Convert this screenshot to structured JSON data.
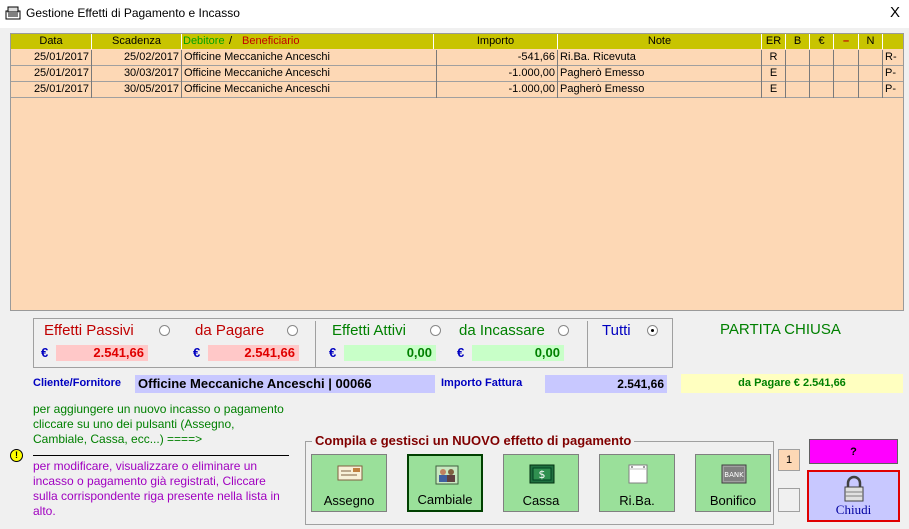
{
  "window": {
    "title": "Gestione Effetti di Pagamento e Incasso",
    "close_label": "X"
  },
  "grid": {
    "headers": {
      "data": "Data",
      "scadenza": "Scadenza",
      "debitore": "Debitore",
      "slash": "/",
      "beneficiario": "Beneficiario",
      "importo": "Importo",
      "note": "Note",
      "er": "ER",
      "b": "B",
      "euro": "€",
      "dash": "–",
      "n": "N"
    },
    "rows": [
      {
        "data": "25/01/2017",
        "scadenza": "25/02/2017",
        "nome": "Officine Meccaniche Anceschi",
        "importo": "-541,66",
        "note": "Ri.Ba. Ricevuta",
        "er": "R",
        "tail": "R-"
      },
      {
        "data": "25/01/2017",
        "scadenza": "30/03/2017",
        "nome": "Officine Meccaniche Anceschi",
        "importo": "-1.000,00",
        "note": "Pagherò Emesso",
        "er": "E",
        "tail": "P-"
      },
      {
        "data": "25/01/2017",
        "scadenza": "30/05/2017",
        "nome": "Officine Meccaniche Anceschi",
        "importo": "-1.000,00",
        "note": "Pagherò Emesso",
        "er": "E",
        "tail": "P-"
      }
    ]
  },
  "filters": {
    "effetti_passivi": "Effetti Passivi",
    "da_pagare": "da Pagare",
    "effetti_attivi": "Effetti Attivi",
    "da_incassare": "da Incassare",
    "tutti": "Tutti",
    "currency": "€",
    "passivi_amount": "2.541,66",
    "da_pagare_amount": "2.541,66",
    "attivi_amount": "0,00",
    "da_incassare_amount": "0,00"
  },
  "status": "PARTITA CHIUSA",
  "cliente": {
    "label": "Cliente/Fornitore",
    "value": "Officine Meccaniche Anceschi | 00066"
  },
  "importo_fattura": {
    "label": "Importo Fattura",
    "value": "2.541,66"
  },
  "da_pagare_summary": "da Pagare  € 2.541,66",
  "help": {
    "add": "per aggiungere un nuovo incasso o pagamento cliccare su uno dei pulsanti (Assegno, Cambiale, Cassa, ecc...) ====>",
    "edit": "per modificare, visualizzare o eliminare un incasso o pagamento già registrati, Cliccare sulla corrispondente riga presente nella lista in alto."
  },
  "new_effect": {
    "title": "Compila e gestisci un NUOVO effetto di pagamento",
    "buttons": {
      "assegno": "Assegno",
      "cambiale": "Cambiale",
      "cassa": "Cassa",
      "riba": "Ri.Ba.",
      "bonifico": "Bonifico"
    }
  },
  "counter": "1",
  "question_label": "?",
  "chiudi_label": "Chiudi",
  "colors": {
    "grid_bg": "#fdd8b5",
    "header_bg": "#c8c400",
    "button_green": "#9ae09a",
    "status_green": "#008000"
  }
}
